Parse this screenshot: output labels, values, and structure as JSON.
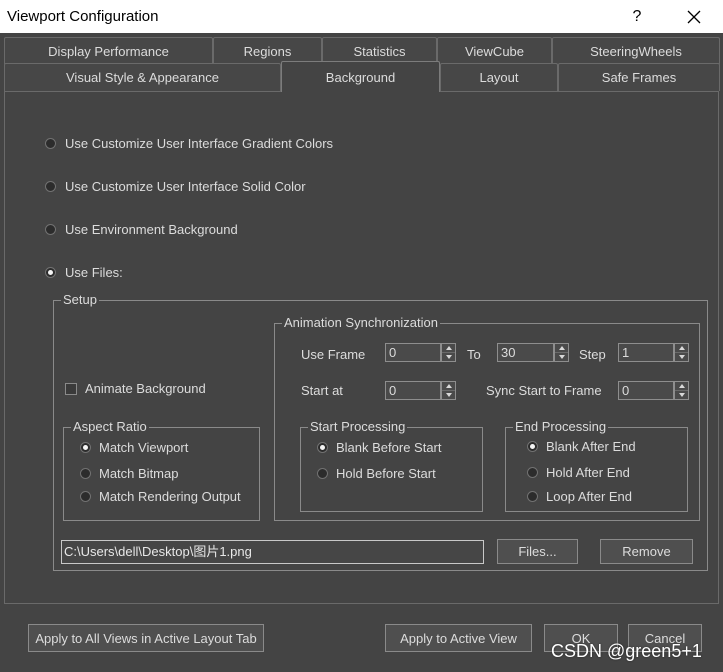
{
  "window": {
    "title": "Viewport Configuration",
    "help_label": "?"
  },
  "tabs": {
    "row1": [
      {
        "label": "Display Performance",
        "selected": false
      },
      {
        "label": "Regions",
        "selected": false
      },
      {
        "label": "Statistics",
        "selected": false
      },
      {
        "label": "ViewCube",
        "selected": false
      },
      {
        "label": "SteeringWheels",
        "selected": false
      }
    ],
    "row2": [
      {
        "label": "Visual Style & Appearance",
        "selected": false
      },
      {
        "label": "Background",
        "selected": true
      },
      {
        "label": "Layout",
        "selected": false
      },
      {
        "label": "Safe Frames",
        "selected": false
      }
    ]
  },
  "background_source": {
    "options": [
      {
        "label": "Use Customize User Interface Gradient Colors",
        "selected": false
      },
      {
        "label": "Use Customize User Interface Solid Color",
        "selected": false
      },
      {
        "label": "Use Environment Background",
        "selected": false
      },
      {
        "label": "Use Files:",
        "selected": true
      }
    ]
  },
  "setup": {
    "title": "Setup",
    "animate_background": {
      "label": "Animate Background",
      "checked": false
    },
    "aspect_ratio": {
      "title": "Aspect Ratio",
      "options": [
        {
          "label": "Match Viewport",
          "selected": true
        },
        {
          "label": "Match Bitmap",
          "selected": false
        },
        {
          "label": "Match Rendering Output",
          "selected": false
        }
      ]
    },
    "animation_sync": {
      "title": "Animation Synchronization",
      "use_frame_label": "Use Frame",
      "use_frame_value": "0",
      "to_label": "To",
      "to_value": "30",
      "step_label": "Step",
      "step_value": "1",
      "start_at_label": "Start at",
      "start_at_value": "0",
      "sync_start_label": "Sync Start to Frame",
      "sync_start_value": "0",
      "start_processing": {
        "title": "Start Processing",
        "options": [
          {
            "label": "Blank Before Start",
            "selected": true
          },
          {
            "label": "Hold Before Start",
            "selected": false
          }
        ]
      },
      "end_processing": {
        "title": "End Processing",
        "options": [
          {
            "label": "Blank After End",
            "selected": true
          },
          {
            "label": "Hold After End",
            "selected": false
          },
          {
            "label": "Loop After End",
            "selected": false
          }
        ]
      }
    },
    "file_path": "C:\\Users\\dell\\Desktop\\图片1.png",
    "files_button": "Files...",
    "remove_button": "Remove"
  },
  "footer": {
    "apply_all_label": "Apply to All Views in Active Layout Tab",
    "apply_active_label": "Apply to Active View",
    "ok_label": "OK",
    "cancel_label": "Cancel"
  },
  "watermark": "CSDN @green5+1",
  "icons": {
    "close": "close-icon",
    "spin_up": "spinner-up-arrow-icon",
    "spin_down": "spinner-down-arrow-icon"
  },
  "colors": {
    "titlebar_bg": "#ffffff",
    "window_bg": "#444444",
    "text": "#dcdcdc"
  }
}
